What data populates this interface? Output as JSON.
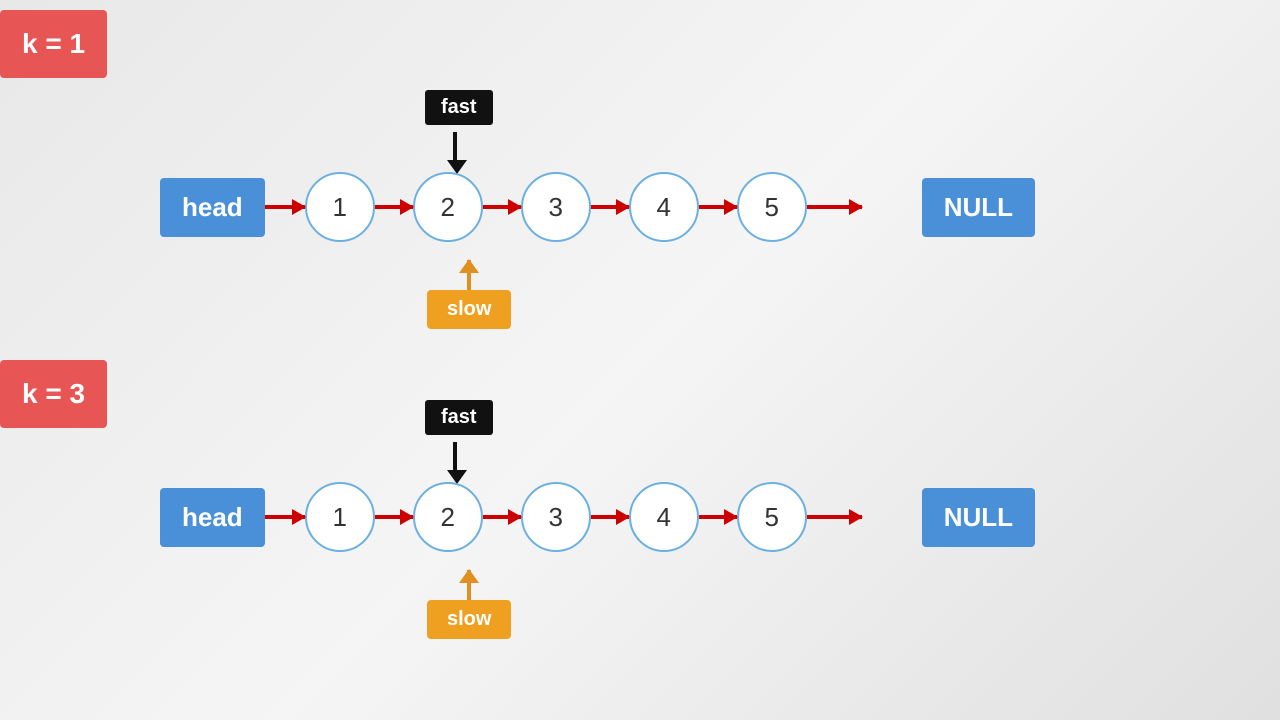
{
  "k1": {
    "label": "k = 1"
  },
  "k3": {
    "label": "k = 3"
  },
  "diagram1": {
    "fast_label": "fast",
    "slow_label": "slow",
    "head_label": "head",
    "null_label": "NULL",
    "nodes": [
      1,
      2,
      3,
      4,
      5
    ]
  },
  "diagram2": {
    "fast_label": "fast",
    "slow_label": "slow",
    "head_label": "head",
    "null_label": "NULL",
    "nodes": [
      1,
      2,
      3,
      4,
      5
    ]
  }
}
